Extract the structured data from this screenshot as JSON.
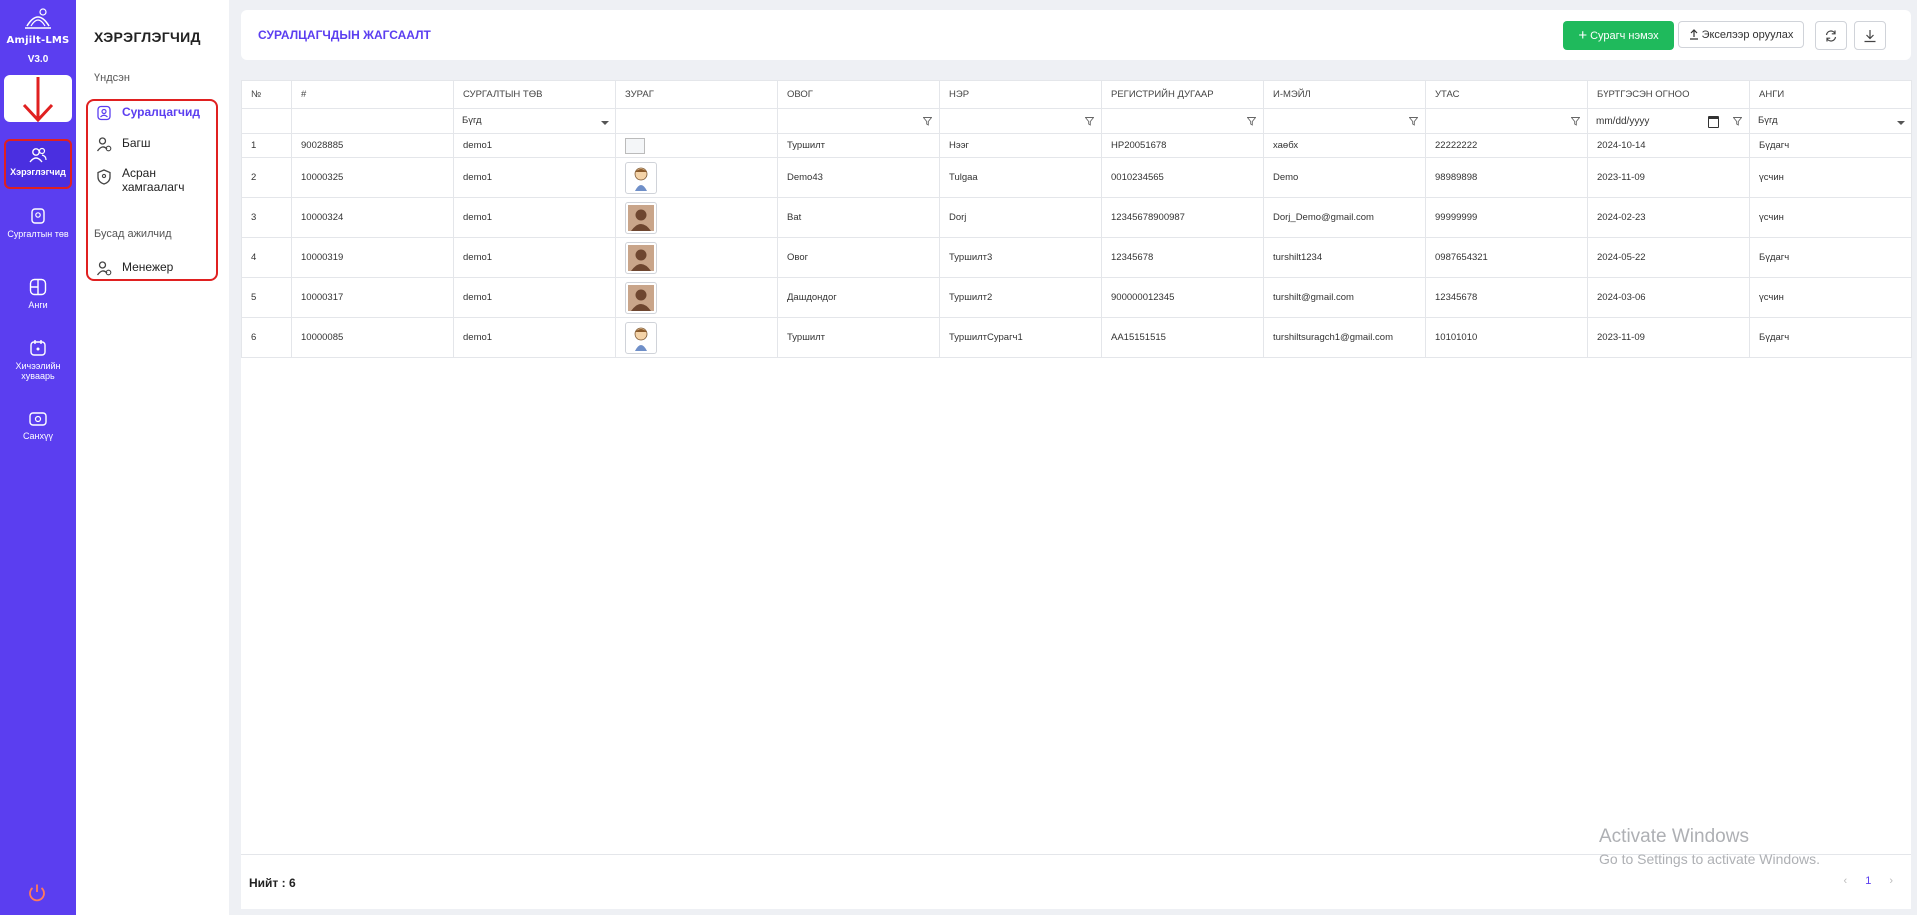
{
  "rail": {
    "brand": "Amjilt-LMS",
    "version": "V3.0",
    "items": [
      {
        "label": "Хэрэглэгчид"
      },
      {
        "label": "Сургалтын төв"
      },
      {
        "label": "Анги"
      },
      {
        "label": "Хичээлийн хуваарь"
      },
      {
        "label": "Санхүү"
      }
    ]
  },
  "sidebar": {
    "title": "ХЭРЭГЛЭГЧИД",
    "section_main": "Үндсэн",
    "section_other": "Бусад ажилчид",
    "items": [
      {
        "label": "Суралцагчид"
      },
      {
        "label": "Багш"
      },
      {
        "label": "Асран хамгаалагч"
      },
      {
        "label": "Менежер"
      }
    ]
  },
  "header": {
    "title": "СУРАЛЦАГЧДЫН ЖАГСААЛТ",
    "add_button": "Сурагч нэмэх",
    "excel_button": "Экселээр оруулах"
  },
  "table": {
    "columns": [
      "№",
      "#",
      "СУРГАЛТЫН ТӨВ",
      "ЗУРАГ",
      "ОВОГ",
      "НЭР",
      "РЕГИСТРИЙН ДУГААР",
      "И-МЭЙЛ",
      "УТАС",
      "БҮРТГЭСЭН ОГНОО",
      "АНГИ"
    ],
    "filters": {
      "center": "Бүгд",
      "date_placeholder": "mm/dd/yyyy",
      "class": "Бүгд"
    },
    "rows": [
      {
        "n": "1",
        "id": "90028885",
        "center": "demo1",
        "photo": "broken",
        "last": "Туршилт",
        "first": "Нээг",
        "reg": "НР20051678",
        "email": "хаөбх",
        "phone": "22222222",
        "date": "2024-10-14",
        "class": "Бүдагч"
      },
      {
        "n": "2",
        "id": "10000325",
        "center": "demo1",
        "photo": "cartoon",
        "last": "Demo43",
        "first": "Tulgaa",
        "reg": "0010234565",
        "email": "Demo",
        "phone": "98989898",
        "date": "2023-11-09",
        "class": "үсчин"
      },
      {
        "n": "3",
        "id": "10000324",
        "center": "demo1",
        "photo": "person",
        "last": "Bat",
        "first": "Dorj",
        "reg": "12345678900987",
        "email": "Dorj_Demo@gmail.com",
        "phone": "99999999",
        "date": "2024-02-23",
        "class": "үсчин"
      },
      {
        "n": "4",
        "id": "10000319",
        "center": "demo1",
        "photo": "person",
        "last": "Овог",
        "first": "Туршилт3",
        "reg": "12345678",
        "email": "turshilt1234",
        "phone": "0987654321",
        "date": "2024-05-22",
        "class": "Бүдагч"
      },
      {
        "n": "5",
        "id": "10000317",
        "center": "demo1",
        "photo": "person",
        "last": "Дашдондог",
        "first": "Туршилт2",
        "reg": "900000012345",
        "email": "turshilt@gmail.com",
        "phone": "12345678",
        "date": "2024-03-06",
        "class": "үсчин"
      },
      {
        "n": "6",
        "id": "10000085",
        "center": "demo1",
        "photo": "cartoon",
        "last": "Туршилт",
        "first": "ТуршилтСурагч1",
        "reg": "АА15151515",
        "email": "turshiltsuragch1@gmail.com",
        "phone": "10101010",
        "date": "2023-11-09",
        "class": "Бүдагч"
      }
    ]
  },
  "footer": {
    "total": "Нийт : 6",
    "page": "1"
  },
  "watermark": {
    "line1": "Activate Windows",
    "line2": "Go to Settings to activate Windows."
  },
  "colors": {
    "accent": "#5b3ef0",
    "add_green": "#1fba5c",
    "highlight_red": "#e02020"
  }
}
